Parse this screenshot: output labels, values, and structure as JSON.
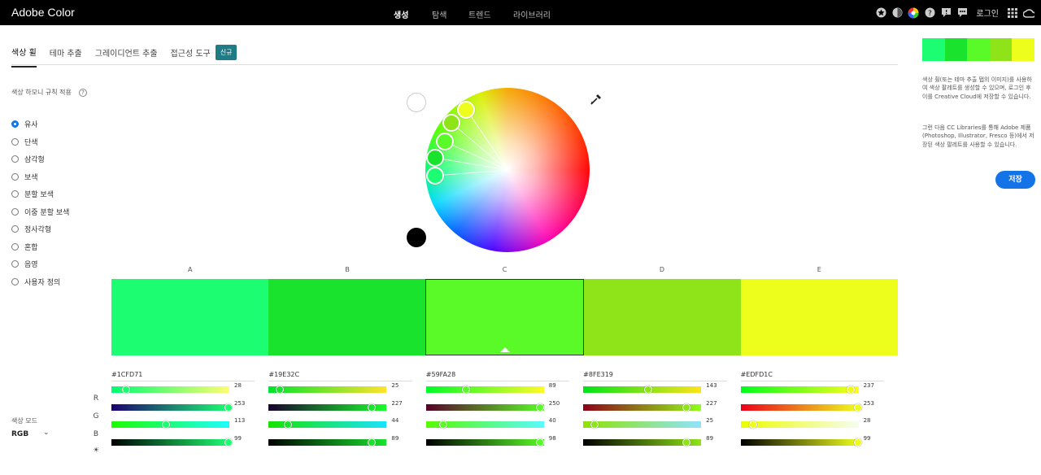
{
  "app": {
    "brand": "Adobe Color"
  },
  "nav": [
    "생성",
    "탐색",
    "트렌드",
    "라이브러리"
  ],
  "topbar": {
    "login": "로그인"
  },
  "tabs": [
    "색상 휠",
    "테마 추출",
    "그레이디언트 추출",
    "접근성 도구"
  ],
  "new_badge": "신규",
  "harmony": {
    "title": "색상 하모니 규칙 적용",
    "help": "?",
    "rules": [
      "유사",
      "단색",
      "삼각형",
      "보색",
      "분할 보색",
      "이중 분할 보색",
      "정사각형",
      "혼합",
      "음영",
      "사용자 정의"
    ],
    "selected": 0
  },
  "color_mode": {
    "label": "색상 모드",
    "value": "RGB",
    "chevron": "⌄"
  },
  "swatch_labels": [
    "A",
    "B",
    "C",
    "D",
    "E"
  ],
  "selected_swatch": 2,
  "channels": [
    "R",
    "G",
    "B",
    "☀"
  ],
  "swatches": [
    {
      "hex": "#1CFD71",
      "values": [
        "28",
        "253",
        "113",
        "99"
      ],
      "color": "#1cfd71"
    },
    {
      "hex": "#19E32C",
      "values": [
        "25",
        "227",
        "44",
        "89"
      ],
      "color": "#19e32c"
    },
    {
      "hex": "#59FA28",
      "values": [
        "89",
        "250",
        "40",
        "98"
      ],
      "color": "#59fa28"
    },
    {
      "hex": "#8FE319",
      "values": [
        "143",
        "227",
        "25",
        "89"
      ],
      "color": "#8fe319"
    },
    {
      "hex": "#EDFD1C",
      "values": [
        "237",
        "253",
        "28",
        "99"
      ],
      "color": "#edfd1c"
    }
  ],
  "right_panel": {
    "text1": "색상 휠(또는 테마 추출 탭의 이미지)를 사용하여 색상 팔레트를 생성할 수 있으며, 로그인 후 이를 Creative Cloud에 저장할 수 있습니다.",
    "text2": "그런 다음 CC Libraries를 통해 Adobe 제품(Photoshop, Illustrator, Fresco 등)에서 저장된 색상 팔레트를 사용할 수 있습니다.",
    "save": "저장"
  }
}
